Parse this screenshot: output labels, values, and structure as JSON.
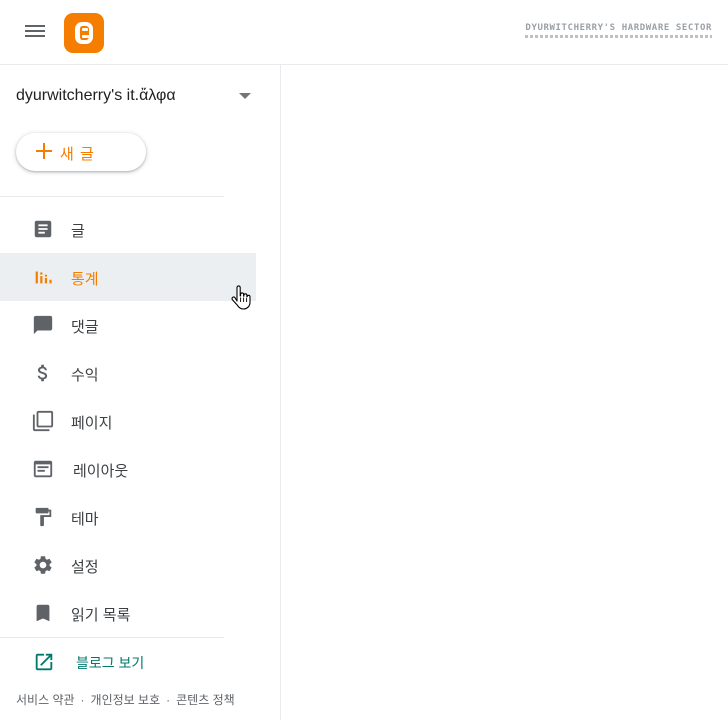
{
  "header": {
    "menu_icon": "hamburger-menu-icon",
    "logo_icon": "blogger-logo-icon",
    "banner_title": "DYURWITCHERRY'S HARDWARE SECTOR",
    "accent_color": "#f57d00"
  },
  "blog_selector": {
    "name": "dyurwitcherry's it.ἄλφα",
    "icon": "dropdown-arrow-icon"
  },
  "new_post": {
    "label": "새 글",
    "icon": "plus-icon"
  },
  "nav": [
    {
      "label": "글",
      "icon": "posts-icon"
    },
    {
      "label": "통계",
      "icon": "stats-icon",
      "active": true
    },
    {
      "label": "댓글",
      "icon": "comment-icon"
    },
    {
      "label": "수익",
      "icon": "dollar-icon"
    },
    {
      "label": "페이지",
      "icon": "pages-icon"
    },
    {
      "label": "레이아웃",
      "icon": "layout-icon"
    },
    {
      "label": "테마",
      "icon": "paint-roller-icon"
    },
    {
      "label": "설정",
      "icon": "gear-icon"
    },
    {
      "label": "읽기 목록",
      "icon": "bookmark-icon"
    }
  ],
  "view_blog": {
    "label": "블로그 보기",
    "icon": "open-in-new-icon",
    "color": "#00796b"
  },
  "footer": {
    "terms": "서비스 약관",
    "privacy": "개인정보 보호",
    "content_policy": "콘텐츠 정책",
    "separator": "·"
  }
}
